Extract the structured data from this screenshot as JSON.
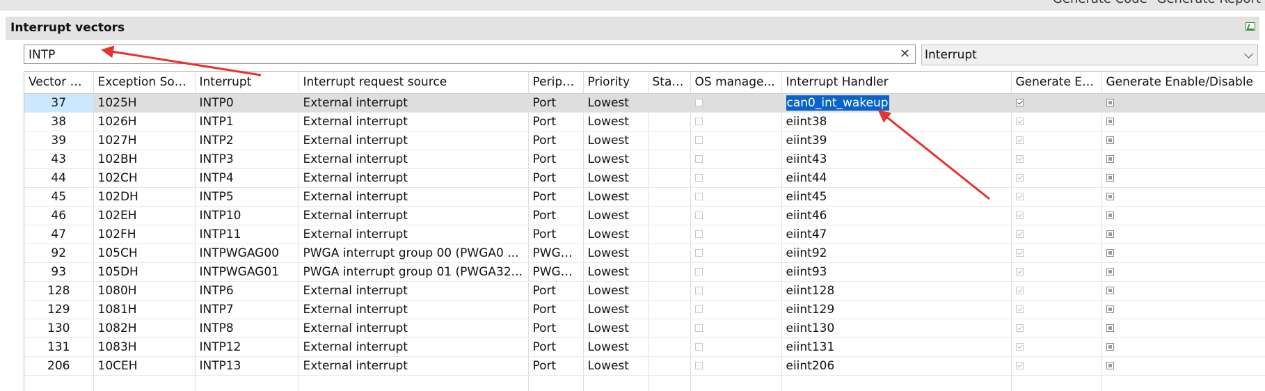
{
  "header": {
    "generate_code_label": "Generate Code",
    "generate_report_label": "Generate Report"
  },
  "section": {
    "title": "Interrupt vectors"
  },
  "search": {
    "value": "INTP"
  },
  "filter": {
    "selected": "Interrupt"
  },
  "table": {
    "columns": [
      "Vector N...",
      "Exception Sou...",
      "Interrupt",
      "Interrupt request source",
      "Periph...",
      "Priority",
      "Stat...",
      "OS manage...",
      "Interrupt Handler",
      "Generate En...",
      "Generate Enable/Disable"
    ],
    "rows": [
      {
        "vector": "37",
        "exception": "1025H",
        "interrupt": "INTP0",
        "source": "External interrupt",
        "peripheral": "Port",
        "priority": "Lowest",
        "handler": "can0_int_wakeup",
        "gen_en_checked": true,
        "selected": true
      },
      {
        "vector": "38",
        "exception": "1026H",
        "interrupt": "INTP1",
        "source": "External interrupt",
        "peripheral": "Port",
        "priority": "Lowest",
        "handler": "eiint38",
        "gen_en_checked": true,
        "selected": false
      },
      {
        "vector": "39",
        "exception": "1027H",
        "interrupt": "INTP2",
        "source": "External interrupt",
        "peripheral": "Port",
        "priority": "Lowest",
        "handler": "eiint39",
        "gen_en_checked": true,
        "selected": false
      },
      {
        "vector": "43",
        "exception": "102BH",
        "interrupt": "INTP3",
        "source": "External interrupt",
        "peripheral": "Port",
        "priority": "Lowest",
        "handler": "eiint43",
        "gen_en_checked": true,
        "selected": false
      },
      {
        "vector": "44",
        "exception": "102CH",
        "interrupt": "INTP4",
        "source": "External interrupt",
        "peripheral": "Port",
        "priority": "Lowest",
        "handler": "eiint44",
        "gen_en_checked": true,
        "selected": false
      },
      {
        "vector": "45",
        "exception": "102DH",
        "interrupt": "INTP5",
        "source": "External interrupt",
        "peripheral": "Port",
        "priority": "Lowest",
        "handler": "eiint45",
        "gen_en_checked": true,
        "selected": false
      },
      {
        "vector": "46",
        "exception": "102EH",
        "interrupt": "INTP10",
        "source": "External interrupt",
        "peripheral": "Port",
        "priority": "Lowest",
        "handler": "eiint46",
        "gen_en_checked": true,
        "selected": false
      },
      {
        "vector": "47",
        "exception": "102FH",
        "interrupt": "INTP11",
        "source": "External interrupt",
        "peripheral": "Port",
        "priority": "Lowest",
        "handler": "eiint47",
        "gen_en_checked": true,
        "selected": false
      },
      {
        "vector": "92",
        "exception": "105CH",
        "interrupt": "INTPWGAG00",
        "source": "PWGA interrupt group 00 (PWGA0 ...",
        "peripheral": "PWGA...",
        "priority": "Lowest",
        "handler": "eiint92",
        "gen_en_checked": true,
        "selected": false
      },
      {
        "vector": "93",
        "exception": "105DH",
        "interrupt": "INTPWGAG01",
        "source": "PWGA interrupt group 01 (PWGA32...",
        "peripheral": "PWGA...",
        "priority": "Lowest",
        "handler": "eiint93",
        "gen_en_checked": true,
        "selected": false
      },
      {
        "vector": "128",
        "exception": "1080H",
        "interrupt": "INTP6",
        "source": "External interrupt",
        "peripheral": "Port",
        "priority": "Lowest",
        "handler": "eiint128",
        "gen_en_checked": true,
        "selected": false
      },
      {
        "vector": "129",
        "exception": "1081H",
        "interrupt": "INTP7",
        "source": "External interrupt",
        "peripheral": "Port",
        "priority": "Lowest",
        "handler": "eiint129",
        "gen_en_checked": true,
        "selected": false
      },
      {
        "vector": "130",
        "exception": "1082H",
        "interrupt": "INTP8",
        "source": "External interrupt",
        "peripheral": "Port",
        "priority": "Lowest",
        "handler": "eiint130",
        "gen_en_checked": true,
        "selected": false
      },
      {
        "vector": "131",
        "exception": "1083H",
        "interrupt": "INTP12",
        "source": "External interrupt",
        "peripheral": "Port",
        "priority": "Lowest",
        "handler": "eiint131",
        "gen_en_checked": true,
        "selected": false
      },
      {
        "vector": "206",
        "exception": "10CEH",
        "interrupt": "INTP13",
        "source": "External interrupt",
        "peripheral": "Port",
        "priority": "Lowest",
        "handler": "eiint206",
        "gen_en_checked": true,
        "selected": false
      }
    ]
  },
  "colors": {
    "selection_blue": "#0a64c8",
    "annotation_arrow": "#e8322b"
  },
  "icons": {
    "clear": "close-icon",
    "dropdown": "chevron-down-icon",
    "export": "export-excel-icon"
  }
}
